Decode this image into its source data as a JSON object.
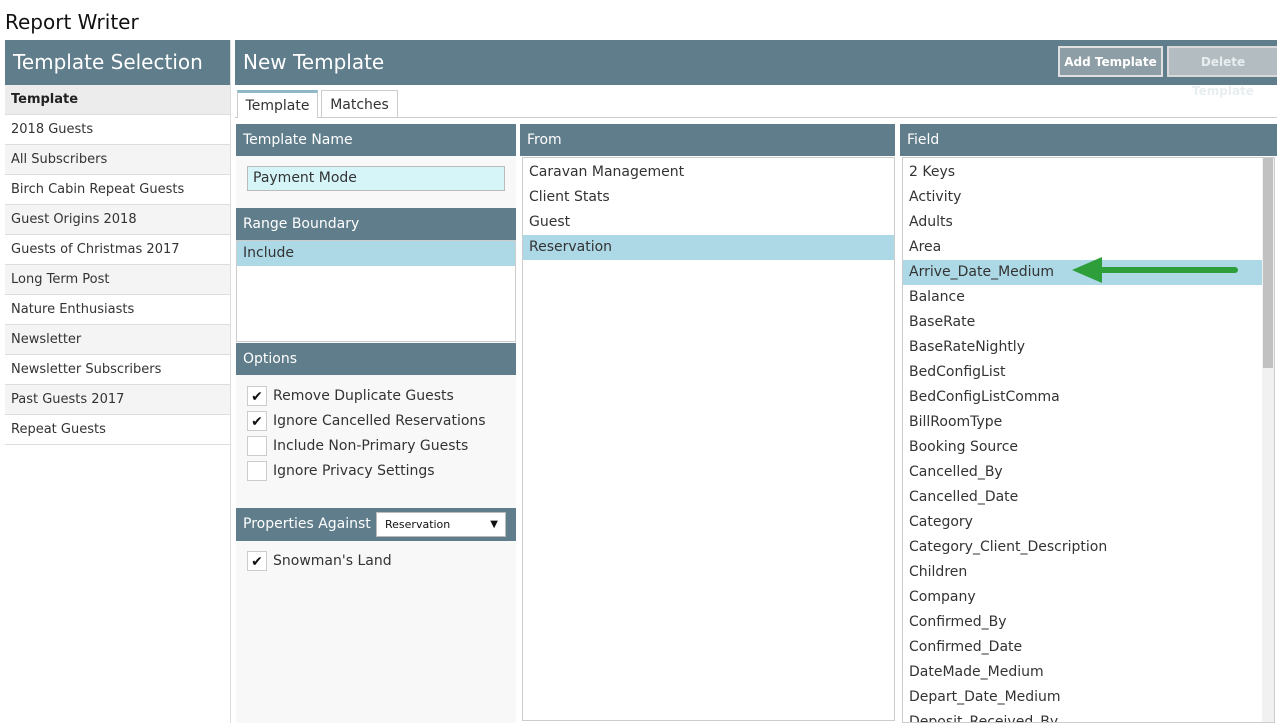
{
  "app_title": "Report Writer",
  "left_panel": {
    "title": "Template Selection",
    "list_header": "Template",
    "items": [
      "2018 Guests",
      "All Subscribers",
      "Birch Cabin Repeat Guests",
      "Guest Origins 2018",
      "Guests of Christmas 2017",
      "Long Term Post",
      "Nature Enthusiasts",
      "Newsletter",
      "Newsletter Subscribers",
      "Past Guests 2017",
      "Repeat Guests"
    ]
  },
  "main": {
    "title": "New Template",
    "add_button": "Add Template",
    "delete_button": "Delete Template",
    "tabs": [
      "Template",
      "Matches"
    ]
  },
  "template_name": {
    "label": "Template Name",
    "value": "Payment Mode"
  },
  "range_boundary": {
    "label": "Range Boundary",
    "selected": "Include"
  },
  "options": {
    "label": "Options",
    "items": [
      {
        "label": "Remove Duplicate Guests",
        "checked": true
      },
      {
        "label": "Ignore Cancelled Reservations",
        "checked": true
      },
      {
        "label": "Include Non-Primary Guests",
        "checked": false
      },
      {
        "label": "Ignore Privacy Settings",
        "checked": false
      }
    ]
  },
  "properties": {
    "label": "Properties Against",
    "select_value": "Reservation",
    "items": [
      {
        "label": "Snowman's Land",
        "checked": true
      }
    ]
  },
  "from": {
    "label": "From",
    "items": [
      "Caravan Management",
      "Client Stats",
      "Guest",
      "Reservation"
    ],
    "selected_index": 3
  },
  "field": {
    "label": "Field",
    "items": [
      "2 Keys",
      "Activity",
      "Adults",
      "Area",
      "Arrive_Date_Medium",
      "Balance",
      "BaseRate",
      "BaseRateNightly",
      "BedConfigList",
      "BedConfigListComma",
      "BillRoomType",
      "Booking Source",
      "Cancelled_By",
      "Cancelled_Date",
      "Category",
      "Category_Client_Description",
      "Children",
      "Company",
      "Confirmed_By",
      "Confirmed_Date",
      "DateMade_Medium",
      "Depart_Date_Medium",
      "Deposit_Received_By"
    ],
    "selected_index": 4
  },
  "annotation": {
    "arrow_color": "#2e9e3a"
  },
  "colors": {
    "header": "#607d8b",
    "selected_row": "#add8e6",
    "name_field_bg": "#d6f5f9"
  }
}
